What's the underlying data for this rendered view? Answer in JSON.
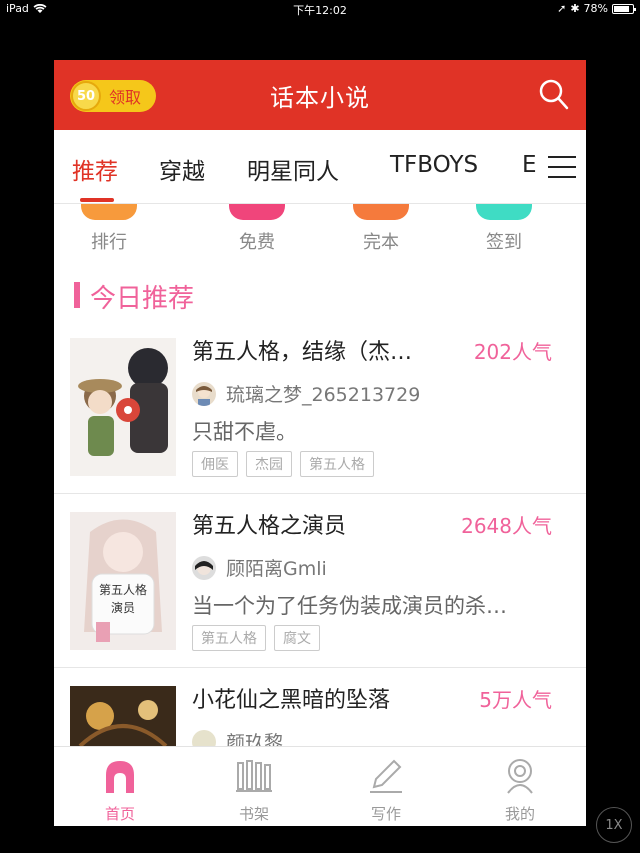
{
  "status_bar": {
    "device": "iPad",
    "time": "下午12:02",
    "battery": "78%"
  },
  "header": {
    "coin_value": "50",
    "coin_label": "领取",
    "title": "话本小说"
  },
  "tabs": [
    {
      "label": "推荐",
      "active": true
    },
    {
      "label": "穿越"
    },
    {
      "label": "明星同人"
    },
    {
      "label": "TFBOYS"
    },
    {
      "label": "EXO"
    }
  ],
  "quick_links": [
    {
      "label": "排行",
      "color": "#f79a3c"
    },
    {
      "label": "免费",
      "color": "#f0457b"
    },
    {
      "label": "完本",
      "color": "#f57a3c"
    },
    {
      "label": "签到",
      "color": "#3fdcc4"
    }
  ],
  "section": {
    "title": "今日推荐"
  },
  "books": [
    {
      "title": "第五人格，结缘（杰…",
      "popularity": "202人气",
      "author": "琉璃之梦_265213729",
      "description": "只甜不虐。",
      "tags": [
        "佣医",
        "杰园",
        "第五人格"
      ]
    },
    {
      "title": "第五人格之演员",
      "popularity": "2648人气",
      "author": "顾陌离Gmli",
      "description": "当一个为了任务伪装成演员的杀…",
      "tags": [
        "第五人格",
        "腐文"
      ]
    },
    {
      "title": "小花仙之黑暗的坠落",
      "popularity": "5万人气",
      "author": "颜玖黎",
      "description": "",
      "tags": []
    }
  ],
  "bottom_nav": [
    {
      "label": "首页",
      "active": true
    },
    {
      "label": "书架"
    },
    {
      "label": "写作"
    },
    {
      "label": "我的"
    }
  ],
  "zoom": "1X",
  "colors": {
    "brand_red": "#e03326",
    "accent_pink": "#f0629a"
  }
}
